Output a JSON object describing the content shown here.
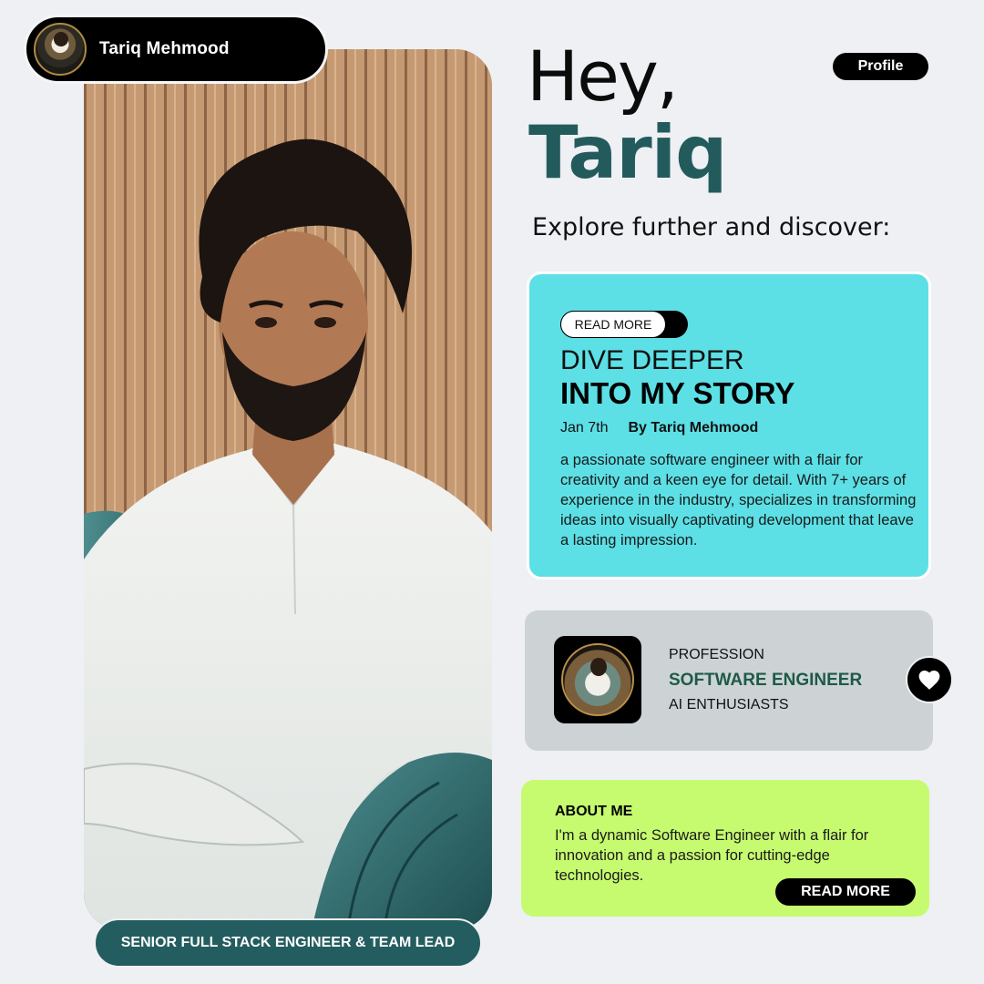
{
  "header": {
    "name": "Tariq Mehmood",
    "profile_tag": "Profile"
  },
  "hero": {
    "greeting": "Hey,",
    "first_name": "Tariq",
    "explore": "Explore further and discover:"
  },
  "photo": {
    "role": "SENIOR FULL STACK ENGINEER & TEAM LEAD"
  },
  "story": {
    "toggle_label": "READ MORE",
    "kicker": "DIVE DEEPER",
    "title": "INTO MY STORY",
    "date": "Jan 7th",
    "author": "By Tariq Mehmood",
    "body": "a passionate software engineer with a flair for creativity and a keen eye for detail. With 7+ years of experience in the industry, specializes in transforming ideas into visually captivating development that leave a lasting impression."
  },
  "profession": {
    "label": "PROFESSION",
    "title": "SOFTWARE ENGINEER",
    "subtitle": "AI ENTHUSIASTS",
    "heart_icon": "heart-icon"
  },
  "about": {
    "heading": "ABOUT ME",
    "body": "I'm a dynamic Software Engineer with a flair for innovation and a passion for cutting-edge technologies.",
    "button": "READ MORE"
  },
  "colors": {
    "background": "#eef0f4",
    "teal": "#235b5d",
    "story_card": "#5ce0e6",
    "profession_card": "#cdd3d4",
    "about_card": "#c6fb70"
  }
}
